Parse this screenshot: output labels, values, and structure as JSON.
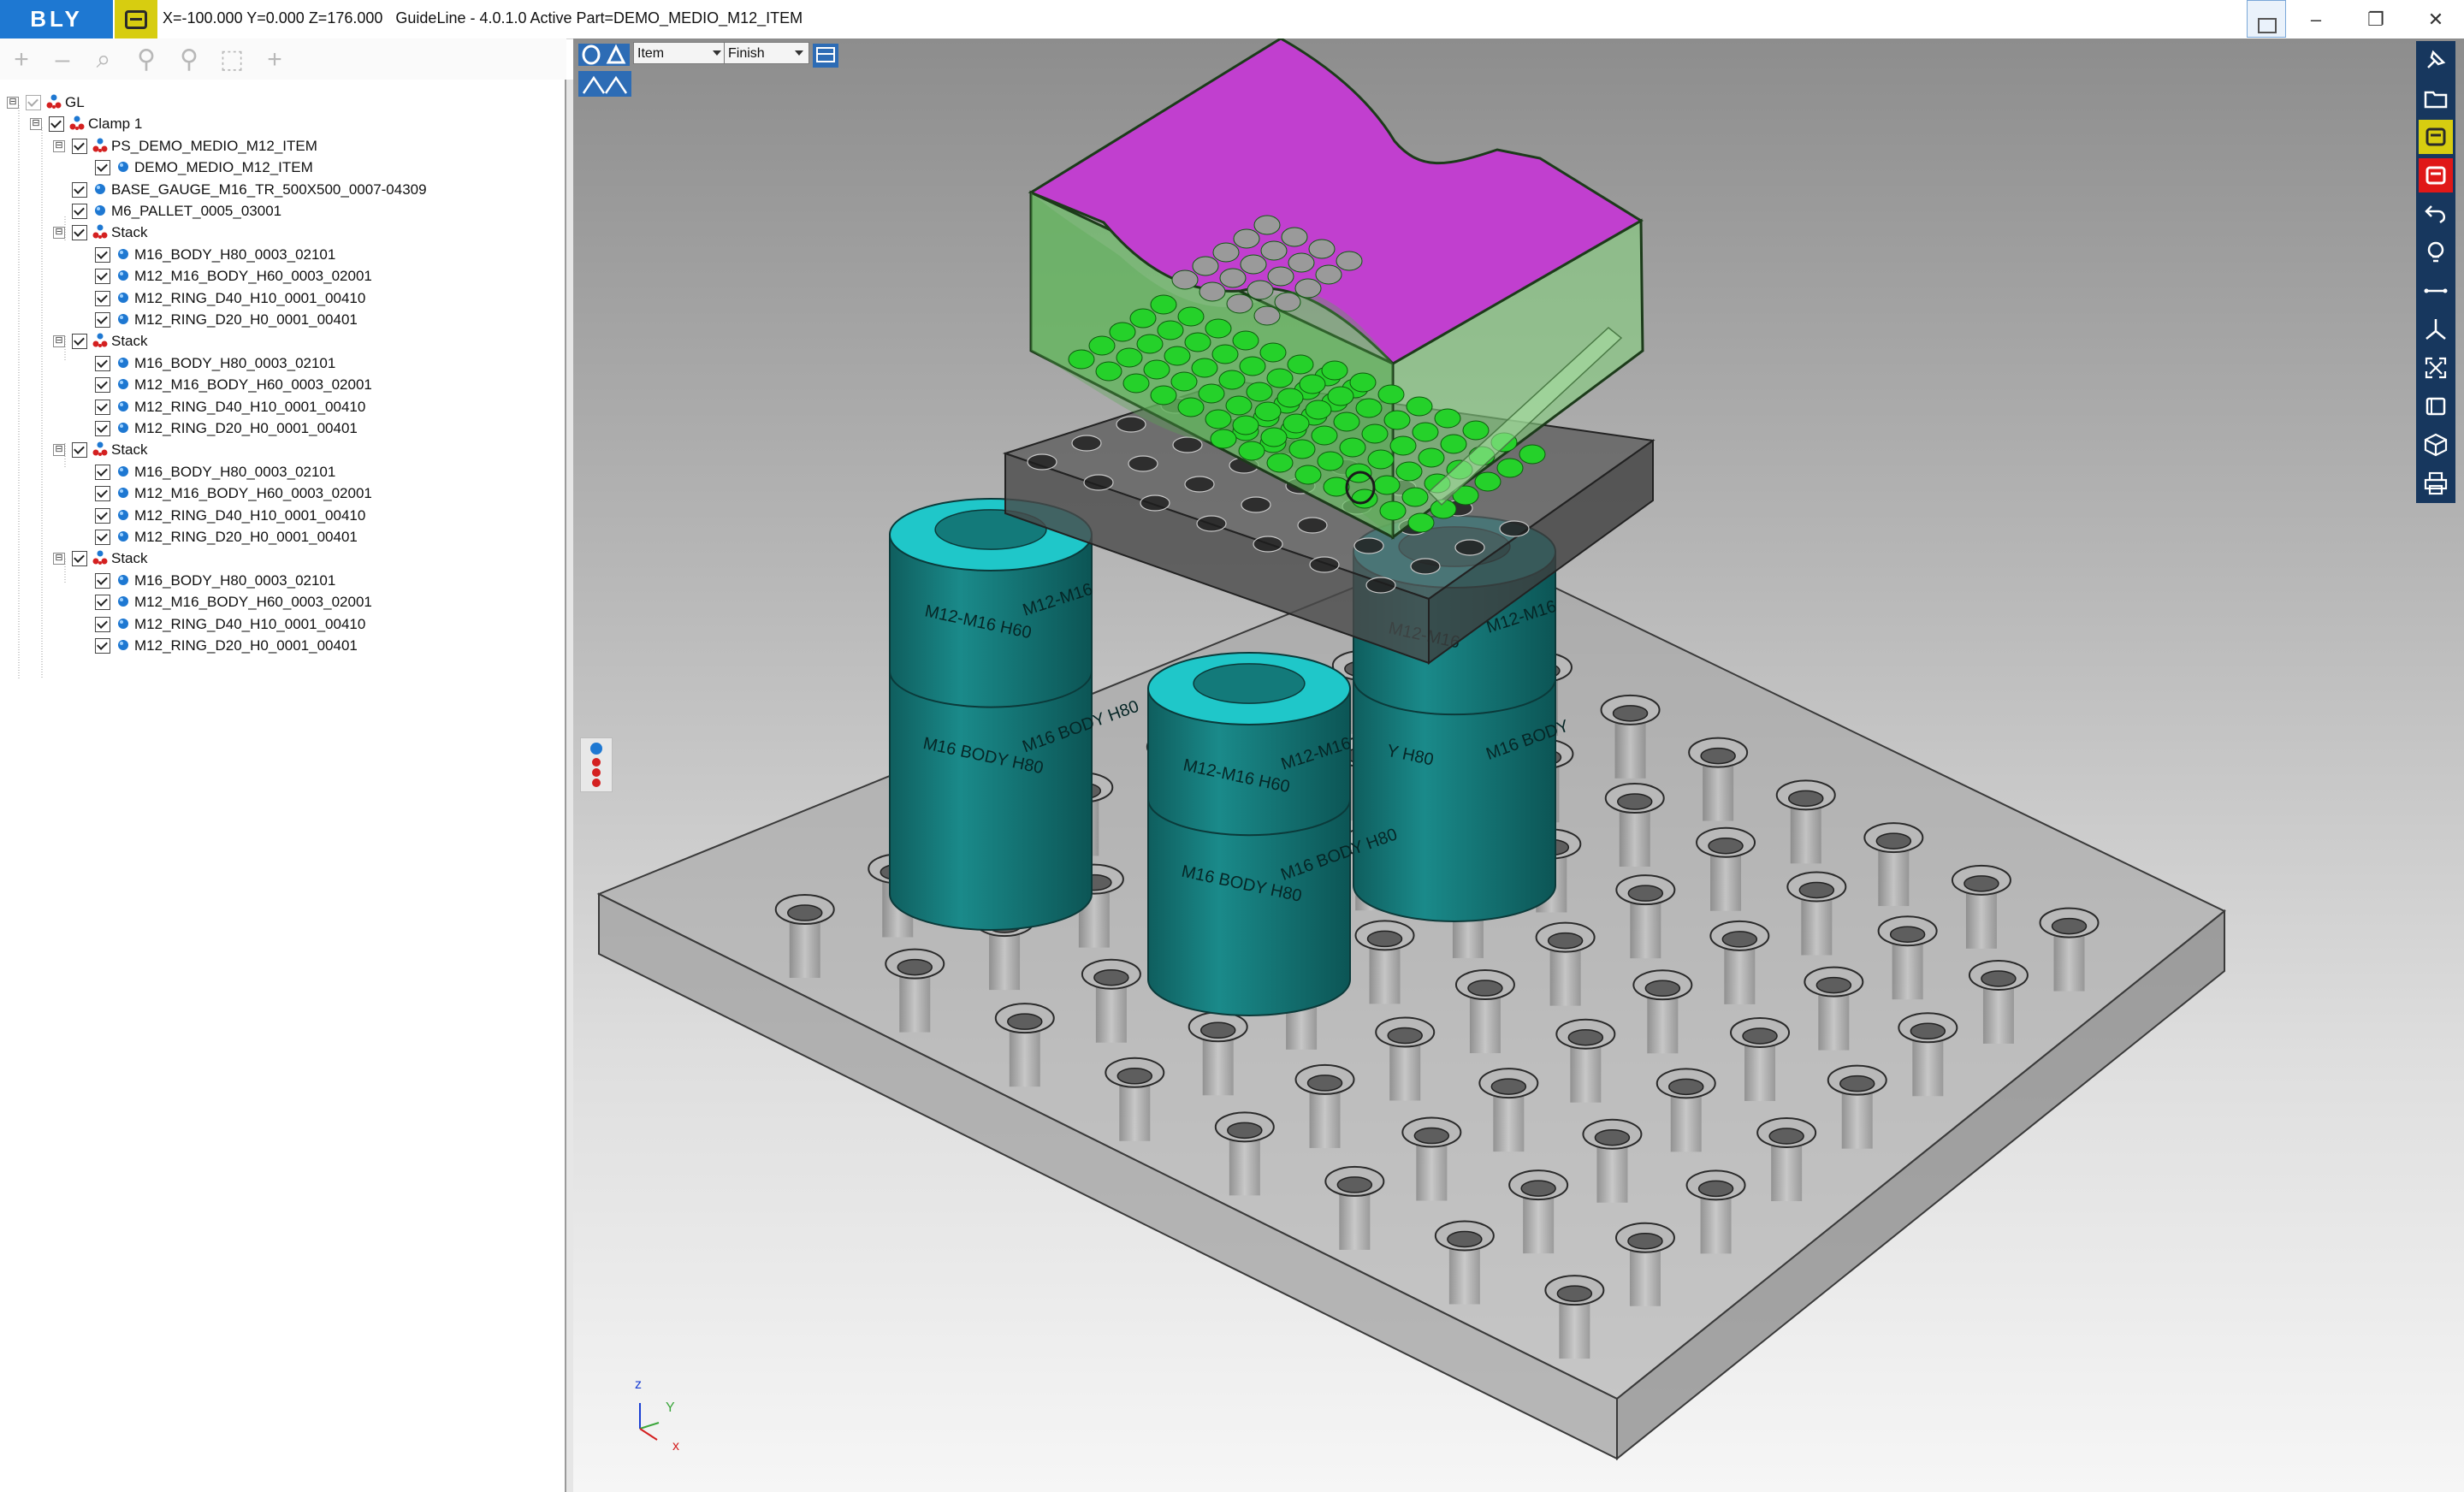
{
  "titlebar": {
    "logo": "BLY",
    "coords": "X=-100.000 Y=0.000 Z=176.000",
    "app": "GuideLine - 4.0.1.0 Active Part=DEMO_MEDIO_M12_ITEM",
    "minimize": "–",
    "restore": "❐",
    "close": "✕"
  },
  "tree_toolbar": [
    "+",
    "–",
    "⌕",
    "⚲",
    "⚲",
    "⬚",
    "+"
  ],
  "tree": [
    {
      "label": "GL",
      "level": 0,
      "icon": "assembly",
      "expander": "⊟",
      "check": "gray"
    },
    {
      "label": "Clamp 1",
      "level": 1,
      "icon": "assembly",
      "expander": "⊟",
      "check": "on"
    },
    {
      "label": "PS_DEMO_MEDIO_M12_ITEM",
      "level": 2,
      "icon": "assembly",
      "expander": "⊟",
      "check": "on"
    },
    {
      "label": "DEMO_MEDIO_M12_ITEM",
      "level": 3,
      "icon": "part",
      "check": "on"
    },
    {
      "label": "BASE_GAUGE_M16_TR_500X500_0007-04309",
      "level": 2,
      "icon": "part",
      "check": "on"
    },
    {
      "label": "M6_PALLET_0005_03001",
      "level": 2,
      "icon": "part",
      "check": "on"
    },
    {
      "label": "Stack",
      "level": 2,
      "icon": "assembly",
      "expander": "⊟",
      "check": "on"
    },
    {
      "label": "M16_BODY_H80_0003_02101",
      "level": 3,
      "icon": "part",
      "check": "on"
    },
    {
      "label": "M12_M16_BODY_H60_0003_02001",
      "level": 3,
      "icon": "part",
      "check": "on"
    },
    {
      "label": "M12_RING_D40_H10_0001_00410",
      "level": 3,
      "icon": "part",
      "check": "on"
    },
    {
      "label": "M12_RING_D20_H0_0001_00401",
      "level": 3,
      "icon": "part",
      "check": "on"
    },
    {
      "label": "Stack",
      "level": 2,
      "icon": "assembly",
      "expander": "⊟",
      "check": "on"
    },
    {
      "label": "M16_BODY_H80_0003_02101",
      "level": 3,
      "icon": "part",
      "check": "on"
    },
    {
      "label": "M12_M16_BODY_H60_0003_02001",
      "level": 3,
      "icon": "part",
      "check": "on"
    },
    {
      "label": "M12_RING_D40_H10_0001_00410",
      "level": 3,
      "icon": "part",
      "check": "on"
    },
    {
      "label": "M12_RING_D20_H0_0001_00401",
      "level": 3,
      "icon": "part",
      "check": "on"
    },
    {
      "label": "Stack",
      "level": 2,
      "icon": "assembly",
      "expander": "⊟",
      "check": "on"
    },
    {
      "label": "M16_BODY_H80_0003_02101",
      "level": 3,
      "icon": "part",
      "check": "on"
    },
    {
      "label": "M12_M16_BODY_H60_0003_02001",
      "level": 3,
      "icon": "part",
      "check": "on"
    },
    {
      "label": "M12_RING_D40_H10_0001_00410",
      "level": 3,
      "icon": "part",
      "check": "on"
    },
    {
      "label": "M12_RING_D20_H0_0001_00401",
      "level": 3,
      "icon": "part",
      "check": "on"
    },
    {
      "label": "Stack",
      "level": 2,
      "icon": "assembly",
      "expander": "⊟",
      "check": "on"
    },
    {
      "label": "M16_BODY_H80_0003_02101",
      "level": 3,
      "icon": "part",
      "check": "on"
    },
    {
      "label": "M12_M16_BODY_H60_0003_02001",
      "level": 3,
      "icon": "part",
      "check": "on"
    },
    {
      "label": "M12_RING_D40_H10_0001_00410",
      "level": 3,
      "icon": "part",
      "check": "on"
    },
    {
      "label": "M12_RING_D20_H0_0001_00401",
      "level": 3,
      "icon": "part",
      "check": "on"
    }
  ],
  "viewport": {
    "select_mode": "Item",
    "select_finish": "Finish",
    "labels": {
      "col_a_top": "M12-M16 H60",
      "col_a_top2": "M12-M16",
      "col_a_bottom": "M16 BODY H80",
      "col_a_bottom2": "M16 BODY H80",
      "col_b_top": "M12-M16 H60",
      "col_b_top2": "M12-M16",
      "col_b_bottom": "M16 BODY H80",
      "col_b_bottom2": "M16 BODY H80",
      "col_c_top": "M12-M16",
      "col_c_top2": "M12-M16",
      "col_c_bottom": "Y H80",
      "col_c_bottom2": "M16 BODY"
    },
    "axes": {
      "z": "z",
      "y": "Y",
      "x": "x"
    }
  },
  "colors": {
    "accent": "#1e78d2",
    "brand_yellow": "#d7cd10",
    "part_magenta": "#c13fcf",
    "part_green": "#8fd48a",
    "stud_green": "#25d12a",
    "column_teal": "#137a7a",
    "ring_cyan": "#1fc7c9",
    "toolbar_navy": "#17375e"
  },
  "right_toolbar": [
    "pin-icon",
    "folder-icon",
    "yellow-box-icon",
    "red-box-icon",
    "undo-icon",
    "bulb-icon",
    "measure-icon",
    "axes-icon",
    "fit-icon",
    "frame-icon",
    "cube-icon",
    "print-icon"
  ]
}
